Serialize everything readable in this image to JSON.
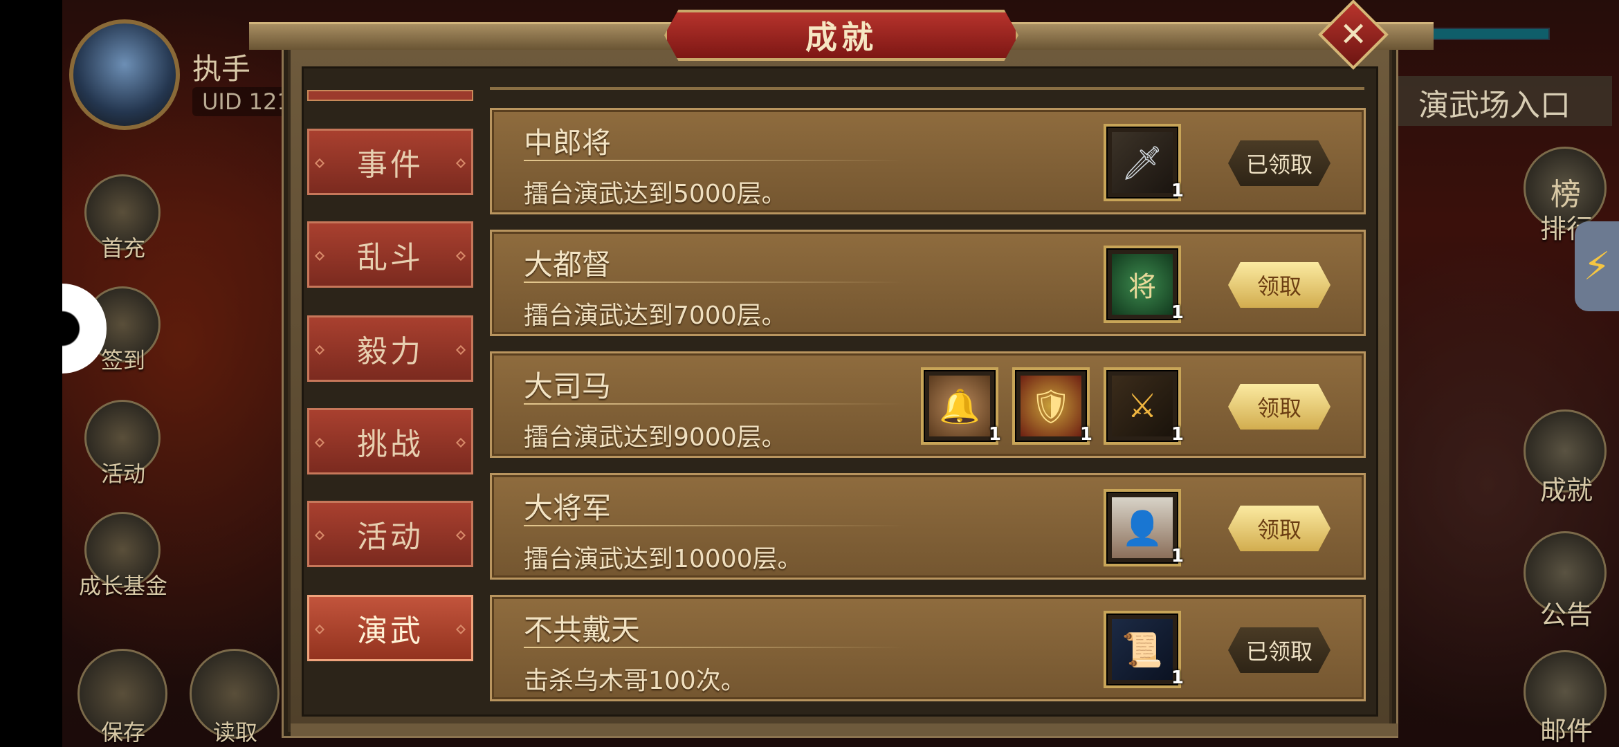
{
  "player": {
    "name": "执手",
    "uid": "UID  121"
  },
  "left_menu": [
    {
      "label": "首充"
    },
    {
      "label": "签到"
    },
    {
      "label": "活动"
    },
    {
      "label": "成长基金"
    },
    {
      "label": "保存"
    },
    {
      "label": "读取"
    }
  ],
  "right_menu": {
    "entrance": "演武场入口",
    "items": [
      {
        "label": "排行",
        "icon_text": "榜"
      },
      {
        "label": "成就"
      },
      {
        "label": "公告"
      },
      {
        "label": "邮件"
      }
    ]
  },
  "dialog": {
    "title": "成就",
    "close_icon": "✕",
    "tabs": [
      {
        "label": "事件",
        "active": false
      },
      {
        "label": "乱斗",
        "active": false
      },
      {
        "label": "毅力",
        "active": false
      },
      {
        "label": "挑战",
        "active": false
      },
      {
        "label": "活动",
        "active": false
      },
      {
        "label": "演武",
        "active": true
      }
    ],
    "rows": [
      {
        "title": "中郎将",
        "desc": "擂台演武达到5000层。",
        "items": [
          {
            "icon": "sword-item",
            "qty": "1"
          }
        ],
        "button": "已领取",
        "claimed": true
      },
      {
        "title": "大都督",
        "desc": "擂台演武达到7000层。",
        "items": [
          {
            "icon": "general-seal-item",
            "qty": "1"
          }
        ],
        "button": "领取",
        "claimed": false
      },
      {
        "title": "大司马",
        "desc": "擂台演武达到9000层。",
        "items": [
          {
            "icon": "bell-item",
            "qty": "1"
          },
          {
            "icon": "armor-item",
            "qty": "1"
          },
          {
            "icon": "golden-blade-item",
            "qty": "1"
          }
        ],
        "button": "领取",
        "claimed": false
      },
      {
        "title": "大将军",
        "desc": "擂台演武达到10000层。",
        "items": [
          {
            "icon": "hero-portrait-item",
            "qty": "1"
          }
        ],
        "button": "领取",
        "claimed": false
      },
      {
        "title": "不共戴天",
        "desc": "击杀乌木哥100次。",
        "items": [
          {
            "icon": "blue-scroll-item",
            "qty": "1"
          }
        ],
        "button": "已领取",
        "claimed": true
      }
    ]
  },
  "colors": {
    "tab_red": "#a9402f",
    "row_bg": "#8f6c3e",
    "claim_gold": "#d2ad4f",
    "claimed_dark": "#2e2416",
    "title_red": "#b6332c"
  }
}
